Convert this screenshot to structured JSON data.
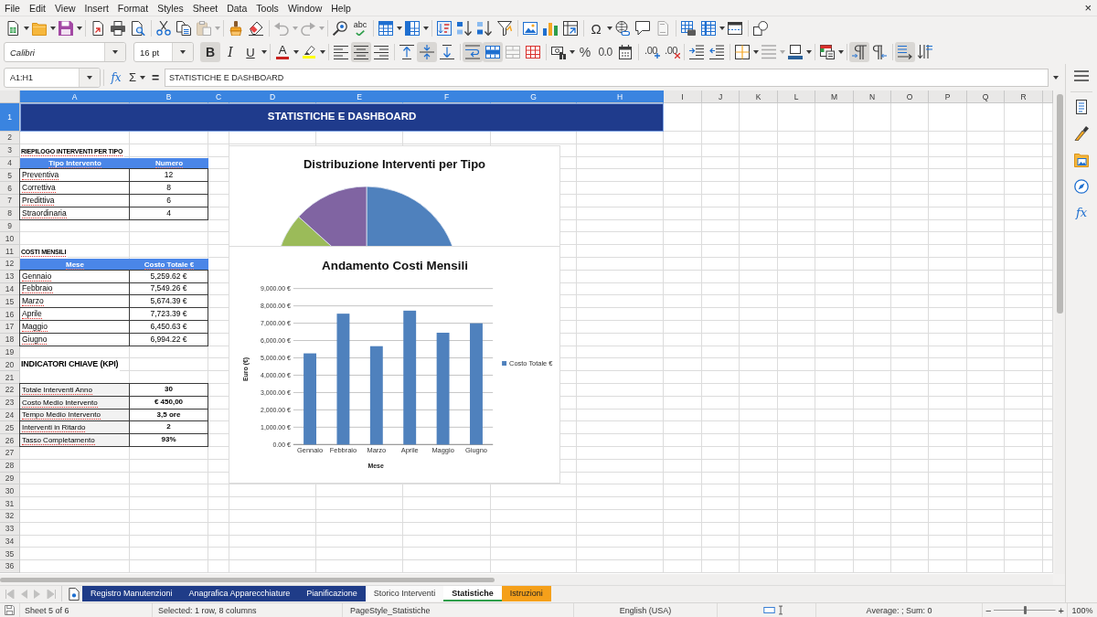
{
  "menu_bar": {
    "items": [
      "File",
      "Edit",
      "View",
      "Insert",
      "Format",
      "Styles",
      "Sheet",
      "Data",
      "Tools",
      "Window",
      "Help"
    ],
    "close": "×"
  },
  "toolbars": [
    {
      "groups": [
        [
          {
            "kind": "new",
            "dropdown": true,
            "disabled": false
          },
          {
            "kind": "open",
            "dropdown": true,
            "disabled": false
          },
          {
            "kind": "save",
            "dropdown": true,
            "disabled": false
          }
        ],
        [
          {
            "kind": "pdf",
            "dropdown": false,
            "disabled": false
          },
          {
            "kind": "print",
            "dropdown": false,
            "disabled": false
          },
          {
            "kind": "preview",
            "dropdown": false,
            "disabled": false
          }
        ],
        [
          {
            "kind": "cut",
            "dropdown": false,
            "disabled": false
          },
          {
            "kind": "copy",
            "dropdown": false,
            "disabled": false
          },
          {
            "kind": "paste",
            "dropdown": true,
            "disabled": true
          }
        ],
        [
          {
            "kind": "clone",
            "dropdown": false,
            "disabled": false
          },
          {
            "kind": "eraser",
            "dropdown": false,
            "disabled": false
          }
        ],
        [
          {
            "kind": "undo",
            "dropdown": true,
            "disabled": true
          },
          {
            "kind": "redo",
            "dropdown": true,
            "disabled": true
          }
        ],
        [
          {
            "kind": "find",
            "dropdown": false,
            "disabled": false
          },
          {
            "kind": "spelling",
            "label": "abc",
            "dropdown": false,
            "disabled": false
          }
        ],
        [
          {
            "kind": "rows",
            "dropdown": true,
            "disabled": false
          },
          {
            "kind": "columns",
            "dropdown": true,
            "disabled": false
          }
        ],
        [
          {
            "kind": "sort",
            "dropdown": false,
            "disabled": false
          },
          {
            "kind": "ascending",
            "dropdown": false,
            "disabled": false
          },
          {
            "kind": "descending",
            "dropdown": false,
            "disabled": false
          },
          {
            "kind": "filter",
            "dropdown": false,
            "disabled": false
          }
        ],
        [
          {
            "kind": "image",
            "dropdown": false,
            "disabled": false
          },
          {
            "kind": "chart",
            "dropdown": false,
            "disabled": false
          },
          {
            "kind": "pivot",
            "dropdown": false,
            "disabled": false
          }
        ],
        [
          {
            "kind": "symbol",
            "label": "Ω",
            "dropdown": true,
            "disabled": false
          },
          {
            "kind": "link",
            "dropdown": false,
            "disabled": false
          },
          {
            "kind": "comment",
            "dropdown": false,
            "disabled": false
          },
          {
            "kind": "headerfooter",
            "dropdown": false,
            "disabled": true
          }
        ],
        [
          {
            "kind": "printarea",
            "dropdown": false,
            "disabled": false
          },
          {
            "kind": "freeze",
            "dropdown": true,
            "disabled": false
          },
          {
            "kind": "split",
            "dropdown": false,
            "disabled": false
          }
        ],
        [
          {
            "kind": "draw",
            "dropdown": false,
            "disabled": false
          }
        ]
      ]
    },
    {
      "font_name": "Calibri",
      "font_size": "16 pt",
      "groups": [
        [
          {
            "kind": "bold",
            "label": "B",
            "pressed": true,
            "dropdown": false,
            "disabled": false
          },
          {
            "kind": "italic",
            "label": "I",
            "pressed": false,
            "dropdown": false,
            "disabled": false
          },
          {
            "kind": "underline",
            "label": "U",
            "pressed": false,
            "dropdown": true,
            "disabled": false
          }
        ],
        [
          {
            "kind": "fontcolor",
            "label": "A",
            "color": "#c9211e",
            "pressed": false,
            "dropdown": true,
            "disabled": false
          },
          {
            "kind": "highlight",
            "color": "#ffff00",
            "pressed": false,
            "dropdown": true,
            "disabled": false
          }
        ],
        [
          {
            "kind": "left",
            "pressed": false,
            "dropdown": false,
            "disabled": false
          },
          {
            "kind": "center",
            "pressed": true,
            "dropdown": false,
            "disabled": false
          },
          {
            "kind": "right",
            "pressed": false,
            "dropdown": false,
            "disabled": false
          }
        ],
        [
          {
            "kind": "top",
            "pressed": false,
            "dropdown": false,
            "disabled": false
          },
          {
            "kind": "middle",
            "pressed": true,
            "dropdown": false,
            "disabled": false
          },
          {
            "kind": "bottom",
            "pressed": false,
            "dropdown": false,
            "disabled": false
          }
        ],
        [
          {
            "kind": "wrap",
            "pressed": true,
            "dropdown": false,
            "disabled": false
          },
          {
            "kind": "mergecenter",
            "pressed": true,
            "dropdown": false,
            "disabled": false
          },
          {
            "kind": "merge",
            "pressed": false,
            "dropdown": false,
            "disabled": true
          },
          {
            "kind": "unmerge",
            "pressed": false,
            "dropdown": false,
            "disabled": false
          }
        ],
        [
          {
            "kind": "currency",
            "pressed": false,
            "dropdown": true,
            "disabled": false
          },
          {
            "kind": "percent",
            "label": "%",
            "pressed": false,
            "dropdown": false,
            "disabled": false
          },
          {
            "kind": "number",
            "label": "0.0",
            "pressed": false,
            "dropdown": false,
            "disabled": false
          },
          {
            "kind": "date",
            "pressed": false,
            "dropdown": false,
            "disabled": false
          }
        ],
        [
          {
            "kind": "adddecimal",
            "label": ".00",
            "pressed": false,
            "dropdown": false,
            "disabled": false
          },
          {
            "kind": "deldecimal",
            "label": ".00",
            "pressed": false,
            "dropdown": false,
            "disabled": false
          }
        ],
        [
          {
            "kind": "indent",
            "pressed": false,
            "dropdown": false,
            "disabled": false
          },
          {
            "kind": "outdent",
            "pressed": false,
            "dropdown": false,
            "disabled": false
          }
        ],
        [
          {
            "kind": "borders",
            "pressed": false,
            "dropdown": true,
            "disabled": false
          },
          {
            "kind": "borderstyle",
            "pressed": false,
            "dropdown": true,
            "disabled": true
          },
          {
            "kind": "bordercolor",
            "pressed": false,
            "dropdown": true,
            "disabled": false
          }
        ],
        [
          {
            "kind": "conditional",
            "pressed": false,
            "dropdown": true,
            "disabled": false
          }
        ],
        [
          {
            "kind": "ltr",
            "pressed": true,
            "dropdown": false,
            "disabled": false
          },
          {
            "kind": "rtl",
            "pressed": false,
            "dropdown": false,
            "disabled": false
          }
        ],
        [
          {
            "kind": "horizontal",
            "pressed": true,
            "dropdown": false,
            "disabled": false
          },
          {
            "kind": "vertical",
            "pressed": false,
            "dropdown": false,
            "disabled": false
          }
        ]
      ]
    }
  ],
  "formula_bar": {
    "name_box": "A1:H1",
    "function_label": "fx",
    "sum_label": "Σ",
    "equals_label": "=",
    "value": "STATISTICHE E DASHBOARD"
  },
  "sidebar": {
    "functions_label": "fx"
  },
  "sheet": {
    "columns": [
      {
        "label": "A",
        "selected": true
      },
      {
        "label": "B",
        "selected": true
      },
      {
        "label": "C",
        "selected": true
      },
      {
        "label": "D",
        "selected": true
      },
      {
        "label": "E",
        "selected": true
      },
      {
        "label": "F",
        "selected": true
      },
      {
        "label": "G",
        "selected": true
      },
      {
        "label": "H",
        "selected": true
      },
      {
        "label": "I",
        "selected": false
      },
      {
        "label": "J",
        "selected": false
      },
      {
        "label": "K",
        "selected": false
      },
      {
        "label": "L",
        "selected": false
      },
      {
        "label": "M",
        "selected": false
      },
      {
        "label": "N",
        "selected": false
      },
      {
        "label": "O",
        "selected": false
      },
      {
        "label": "P",
        "selected": false
      },
      {
        "label": "Q",
        "selected": false
      },
      {
        "label": "R",
        "selected": false
      }
    ],
    "rows": [
      {
        "label": "1",
        "selected": true,
        "cells": [
          {
            "kind": "title",
            "text": "STATISTICHE E DASHBOARD",
            "misspelled": false
          }
        ]
      },
      {
        "label": "2",
        "selected": false
      },
      {
        "label": "3",
        "selected": false,
        "cells": [
          {
            "kind": "heading",
            "text": "RIEPILOGO INTERVENTI PER TIPO",
            "misspelled": true
          }
        ]
      },
      {
        "label": "4",
        "selected": false,
        "cells": [
          {
            "kind": "header",
            "text": "Tipo Intervento",
            "misspelled": true
          },
          {
            "kind": "header",
            "text": "Numero",
            "misspelled": true
          }
        ]
      },
      {
        "label": "5",
        "selected": false,
        "cells": [
          {
            "kind": "label",
            "text": "Preventiva",
            "misspelled": true
          },
          {
            "kind": "value",
            "text": "12",
            "misspelled": false
          }
        ]
      },
      {
        "label": "6",
        "selected": false,
        "cells": [
          {
            "kind": "label",
            "text": "Correttiva",
            "misspelled": true
          },
          {
            "kind": "value",
            "text": "8",
            "misspelled": false
          }
        ]
      },
      {
        "label": "7",
        "selected": false,
        "cells": [
          {
            "kind": "label",
            "text": "Predittiva",
            "misspelled": true
          },
          {
            "kind": "value",
            "text": "6",
            "misspelled": false
          }
        ]
      },
      {
        "label": "8",
        "selected": false,
        "cells": [
          {
            "kind": "label",
            "text": "Straordinaria",
            "misspelled": true
          },
          {
            "kind": "value",
            "text": "4",
            "misspelled": false
          }
        ]
      },
      {
        "label": "9",
        "selected": false
      },
      {
        "label": "10",
        "selected": false
      },
      {
        "label": "11",
        "selected": false,
        "cells": [
          {
            "kind": "heading",
            "text": "COSTI MENSILI",
            "misspelled": true
          }
        ]
      },
      {
        "label": "12",
        "selected": false,
        "cells": [
          {
            "kind": "header",
            "text": "Mese",
            "misspelled": true
          },
          {
            "kind": "header",
            "text": "Costo Totale €",
            "misspelled": true
          }
        ]
      },
      {
        "label": "13",
        "selected": false,
        "cells": [
          {
            "kind": "label",
            "text": "Gennaio",
            "misspelled": true
          },
          {
            "kind": "value",
            "text": "5,259.62 €",
            "misspelled": false
          }
        ]
      },
      {
        "label": "14",
        "selected": false,
        "cells": [
          {
            "kind": "label",
            "text": "Febbraio",
            "misspelled": true
          },
          {
            "kind": "value",
            "text": "7,549.26 €",
            "misspelled": false
          }
        ]
      },
      {
        "label": "15",
        "selected": false,
        "cells": [
          {
            "kind": "label",
            "text": "Marzo",
            "misspelled": true
          },
          {
            "kind": "value",
            "text": "5,674.39 €",
            "misspelled": false
          }
        ]
      },
      {
        "label": "16",
        "selected": false,
        "cells": [
          {
            "kind": "label",
            "text": "Aprile",
            "misspelled": true
          },
          {
            "kind": "value",
            "text": "7,723.39 €",
            "misspelled": false
          }
        ]
      },
      {
        "label": "17",
        "selected": false,
        "cells": [
          {
            "kind": "label",
            "text": "Maggio",
            "misspelled": true
          },
          {
            "kind": "value",
            "text": "6,450.63 €",
            "misspelled": false
          }
        ]
      },
      {
        "label": "18",
        "selected": false,
        "cells": [
          {
            "kind": "label",
            "text": "Giugno",
            "misspelled": true
          },
          {
            "kind": "value",
            "text": "6,994.22 €",
            "misspelled": false
          }
        ]
      },
      {
        "label": "19",
        "selected": false
      },
      {
        "label": "20",
        "selected": false,
        "cells": [
          {
            "kind": "kpiheading",
            "text": "INDICATORI CHIAVE (KPI)",
            "misspelled": false
          }
        ]
      },
      {
        "label": "21",
        "selected": false
      },
      {
        "label": "22",
        "selected": false,
        "cells": [
          {
            "kind": "kpilabel",
            "text": "Totale Interventi Anno",
            "misspelled": true
          },
          {
            "kind": "kpivalue",
            "text": "30",
            "misspelled": false
          }
        ]
      },
      {
        "label": "23",
        "selected": false,
        "cells": [
          {
            "kind": "kpilabel",
            "text": "Costo Medio Intervento",
            "misspelled": true
          },
          {
            "kind": "kpivalue",
            "text": "€ 450,00",
            "misspelled": false
          }
        ]
      },
      {
        "label": "24",
        "selected": false,
        "cells": [
          {
            "kind": "kpilabel",
            "text": "Tempo Medio Intervento",
            "misspelled": true
          },
          {
            "kind": "kpivalue",
            "text": "3,5 ore",
            "misspelled": false
          }
        ]
      },
      {
        "label": "25",
        "selected": false,
        "cells": [
          {
            "kind": "kpilabel",
            "text": "Interventi in Ritardo",
            "misspelled": true
          },
          {
            "kind": "kpivalue",
            "text": "2",
            "misspelled": false
          }
        ]
      },
      {
        "label": "26",
        "selected": false,
        "cells": [
          {
            "kind": "kpilabel",
            "text": "Tasso Completamento",
            "misspelled": true
          },
          {
            "kind": "kpivalue",
            "text": "93%",
            "misspelled": false
          }
        ]
      },
      {
        "label": "27",
        "selected": false
      },
      {
        "label": "28",
        "selected": false
      },
      {
        "label": "29",
        "selected": false
      },
      {
        "label": "30",
        "selected": false
      },
      {
        "label": "31",
        "selected": false
      },
      {
        "label": "32",
        "selected": false
      },
      {
        "label": "33",
        "selected": false
      },
      {
        "label": "34",
        "selected": false
      },
      {
        "label": "35",
        "selected": false
      },
      {
        "label": "36",
        "selected": false
      }
    ]
  },
  "charts": [
    {
      "kind": "pie",
      "title": "Distribuzione Interventi per Tipo"
    },
    {
      "kind": "plot",
      "chart_data": {
        "type": "bar",
        "title": "Andamento Costi Mensili",
        "xlabel": "Mese",
        "ylabel": "Euro (€)",
        "categories": [
          "Gennaio",
          "Febbraio",
          "Marzo",
          "Aprile",
          "Maggio",
          "Giugno"
        ],
        "series": [
          {
            "name": "Costo Totale €",
            "color": "#4f81bd",
            "values": [
              5259.62,
              7549.26,
              5674.39,
              7723.39,
              6450.63,
              6994.22
            ]
          }
        ],
        "ylim": [
          0,
          9000
        ],
        "grid": true,
        "yticks": [
          {
            "value": 0,
            "label": "0.00 €"
          },
          {
            "value": 1000,
            "label": "1,000.00 €"
          },
          {
            "value": 2000,
            "label": "2,000.00 €"
          },
          {
            "value": 3000,
            "label": "3,000.00 €"
          },
          {
            "value": 4000,
            "label": "4,000.00 €"
          },
          {
            "value": 5000,
            "label": "5,000.00 €"
          },
          {
            "value": 6000,
            "label": "6,000.00 €"
          },
          {
            "value": 7000,
            "label": "7,000.00 €"
          },
          {
            "value": 8000,
            "label": "8,000.00 €"
          },
          {
            "value": 9000,
            "label": "9,000.00 €"
          }
        ]
      }
    }
  ],
  "sheet_tabs": {
    "scroll_disabled": true,
    "tabs": [
      {
        "label": "Registro Manutenzioni",
        "selected": false,
        "color": "#1f3c88"
      },
      {
        "label": "Anagrafica Apparecchiature",
        "selected": false,
        "color": "#1f3c88"
      },
      {
        "label": "Pianificazione",
        "selected": false,
        "color": "#1f3c88"
      },
      {
        "label": "Storico Interventi",
        "selected": false
      },
      {
        "label": "Statistiche",
        "selected": true,
        "color": "#2e9e4b"
      },
      {
        "label": "Istruzioni",
        "selected": false,
        "color": "#f5a01a"
      }
    ]
  },
  "status_bar": {
    "sheet": "Sheet 5 of 6",
    "selection": "Selected: 1 row, 8 columns",
    "page_style": "PageStyle_Statistiche",
    "language": "English (USA)",
    "summary": "Average: ; Sum: 0",
    "zoom": {
      "minus": "−",
      "plus": "+",
      "level": 0.5,
      "label": "100%"
    }
  }
}
